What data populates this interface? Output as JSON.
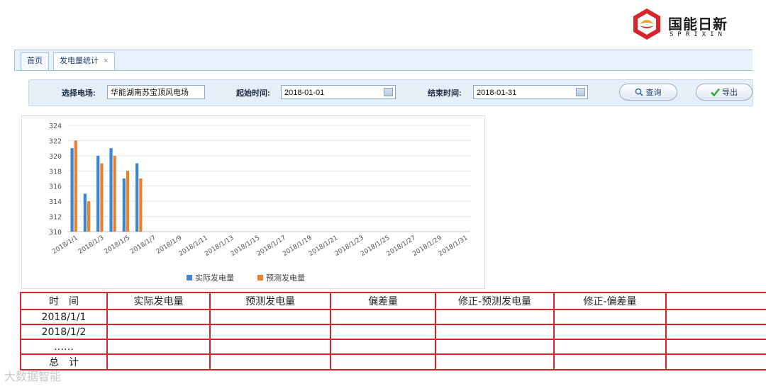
{
  "brand": {
    "name_cn": "国能日新",
    "name_en": "SPRIXIN"
  },
  "tabs": [
    {
      "label": "首页"
    },
    {
      "label": "发电量统计"
    }
  ],
  "tab_close_glyph": "×",
  "filter": {
    "station_label": "选择电场:",
    "station_value": "华能湖南苏宝顶风电场",
    "start_label": "起始时间:",
    "start_value": "2018-01-01",
    "end_label": "结束时间:",
    "end_value": "2018-01-31",
    "query_button": "查询",
    "export_button": "导出",
    "query_icon": "search-icon",
    "export_icon": "check-icon",
    "calendar_icon": "calendar-icon"
  },
  "chart_data": {
    "type": "bar",
    "categories": [
      "2018/1/1",
      "2018/1/2",
      "2018/1/3",
      "2018/1/4",
      "2018/1/5",
      "2018/1/6",
      "2018/1/7",
      "2018/1/8",
      "2018/1/9",
      "2018/1/10",
      "2018/1/11",
      "2018/1/12",
      "2018/1/13",
      "2018/1/14",
      "2018/1/15",
      "2018/1/16",
      "2018/1/17",
      "2018/1/18",
      "2018/1/19",
      "2018/1/20",
      "2018/1/21",
      "2018/1/22",
      "2018/1/23",
      "2018/1/24",
      "2018/1/25",
      "2018/1/26",
      "2018/1/27",
      "2018/1/28",
      "2018/1/29",
      "2018/1/30",
      "2018/1/31"
    ],
    "tick_labels": [
      "2018/1/1",
      "2018/1/3",
      "2018/1/5",
      "2018/1/7",
      "2018/1/9",
      "2018/1/11",
      "2018/1/13",
      "2018/1/15",
      "2018/1/17",
      "2018/1/19",
      "2018/1/21",
      "2018/1/23",
      "2018/1/25",
      "2018/1/27",
      "2018/1/29",
      "2018/1/31"
    ],
    "series": [
      {
        "name": "实际发电量",
        "color": "#3b86d4",
        "values": [
          321,
          315,
          320,
          321,
          317,
          319
        ]
      },
      {
        "name": "预测发电量",
        "color": "#f07f2c",
        "values": [
          322,
          314,
          319,
          320,
          318,
          317
        ]
      }
    ],
    "ylim": [
      310,
      324
    ],
    "yticks": [
      310,
      312,
      314,
      316,
      318,
      320,
      322,
      324
    ],
    "grid": true,
    "legend": "bottom"
  },
  "table": {
    "headers": [
      "时　间",
      "实际发电量",
      "预测发电量",
      "偏差量",
      "修正-预测发电量",
      "修正-偏差量",
      ""
    ],
    "rows": [
      [
        "2018/1/1",
        "",
        "",
        "",
        "",
        "",
        ""
      ],
      [
        "2018/1/2",
        "",
        "",
        "",
        "",
        "",
        ""
      ],
      [
        "……",
        "",
        "",
        "",
        "",
        "",
        ""
      ],
      [
        "总　计",
        "",
        "",
        "",
        "",
        "",
        ""
      ]
    ]
  },
  "watermark": "大数据智能"
}
